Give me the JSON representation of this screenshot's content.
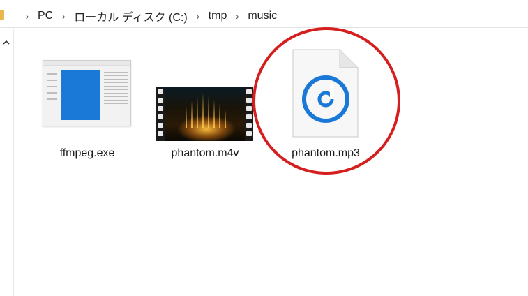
{
  "address_bar": {
    "breadcrumbs": [
      "PC",
      "ローカル ディスク (C:)",
      "tmp",
      "music"
    ]
  },
  "files": [
    {
      "name": "ffmpeg.exe",
      "icon": "exe-window-icon"
    },
    {
      "name": "phantom.m4v",
      "icon": "video-thumbnail"
    },
    {
      "name": "phantom.mp3",
      "icon": "groove-music-icon",
      "highlighted": true
    }
  ],
  "colors": {
    "highlight_circle": "#d51f1f",
    "music_icon_blue": "#1a78d6",
    "folder_yellow": "#e8b84a"
  }
}
